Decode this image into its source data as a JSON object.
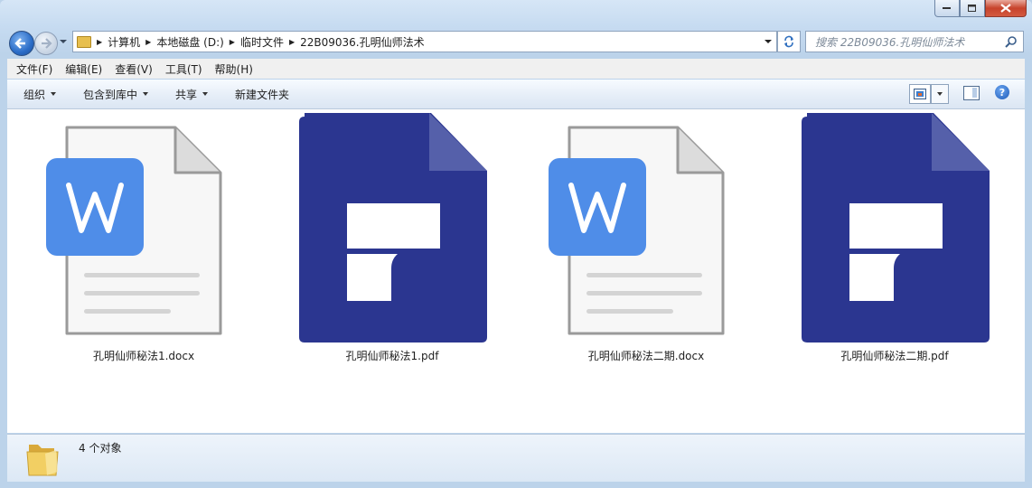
{
  "window": {
    "caption_blur_text": "",
    "caption_right_blur": ""
  },
  "address": {
    "crumbs": [
      "计算机",
      "本地磁盘 (D:)",
      "临时文件",
      "22B09036.孔明仙师法术"
    ]
  },
  "search": {
    "placeholder": "搜索 22B09036.孔明仙师法术"
  },
  "menu": {
    "items": [
      "文件(F)",
      "编辑(E)",
      "查看(V)",
      "工具(T)",
      "帮助(H)"
    ]
  },
  "commands": {
    "organize": "组织",
    "include_library": "包含到库中",
    "share": "共享",
    "new_folder": "新建文件夹"
  },
  "files": [
    {
      "name": "孔明仙师秘法1.docx",
      "icon": "word-doc-icon",
      "color": "#4f8de8"
    },
    {
      "name": "孔明仙师秘法1.pdf",
      "icon": "pdf-icon",
      "color": "#2b3690"
    },
    {
      "name": "孔明仙师秘法二期.docx",
      "icon": "word-doc-icon",
      "color": "#4f8de8"
    },
    {
      "name": "孔明仙师秘法二期.pdf",
      "icon": "pdf-icon",
      "color": "#2b3690"
    }
  ],
  "status": {
    "text": "4 个对象"
  },
  "colors": {
    "word_blue": "#4f8de8",
    "pdf_navy": "#2b3690",
    "pdf_fold": "#5560aa",
    "close_red": "#c7432c"
  }
}
